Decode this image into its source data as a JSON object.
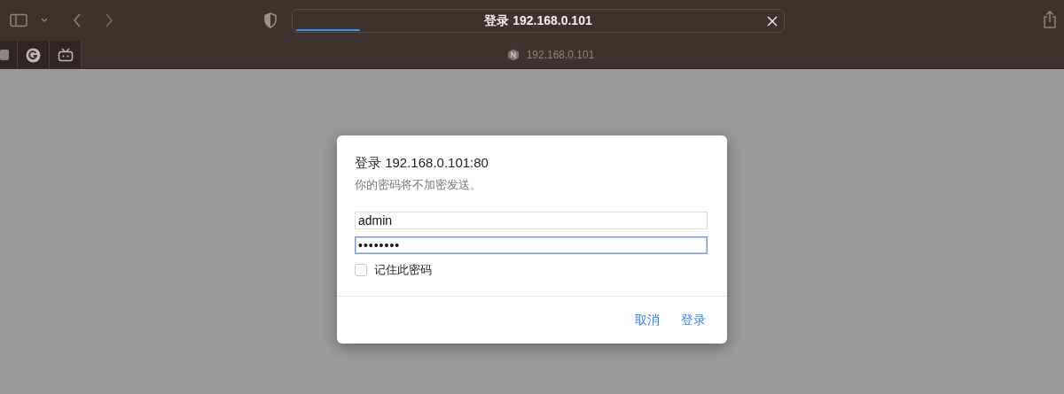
{
  "browser": {
    "address": "登录 192.168.0.101",
    "loading": {
      "level": 0.13
    },
    "tab_title": "192.168.0.101"
  },
  "dialog": {
    "title": "登录 192.168.0.101:80",
    "subtitle": "你的密码将不加密发送。",
    "fields": [
      {
        "kind": "text",
        "value": "admin",
        "focused": false
      },
      {
        "kind": "password",
        "value": "••••••••",
        "focused": true
      }
    ],
    "remember": {
      "label": "记住此密码",
      "checked": false
    },
    "buttons": [
      "取消",
      "登录"
    ]
  }
}
